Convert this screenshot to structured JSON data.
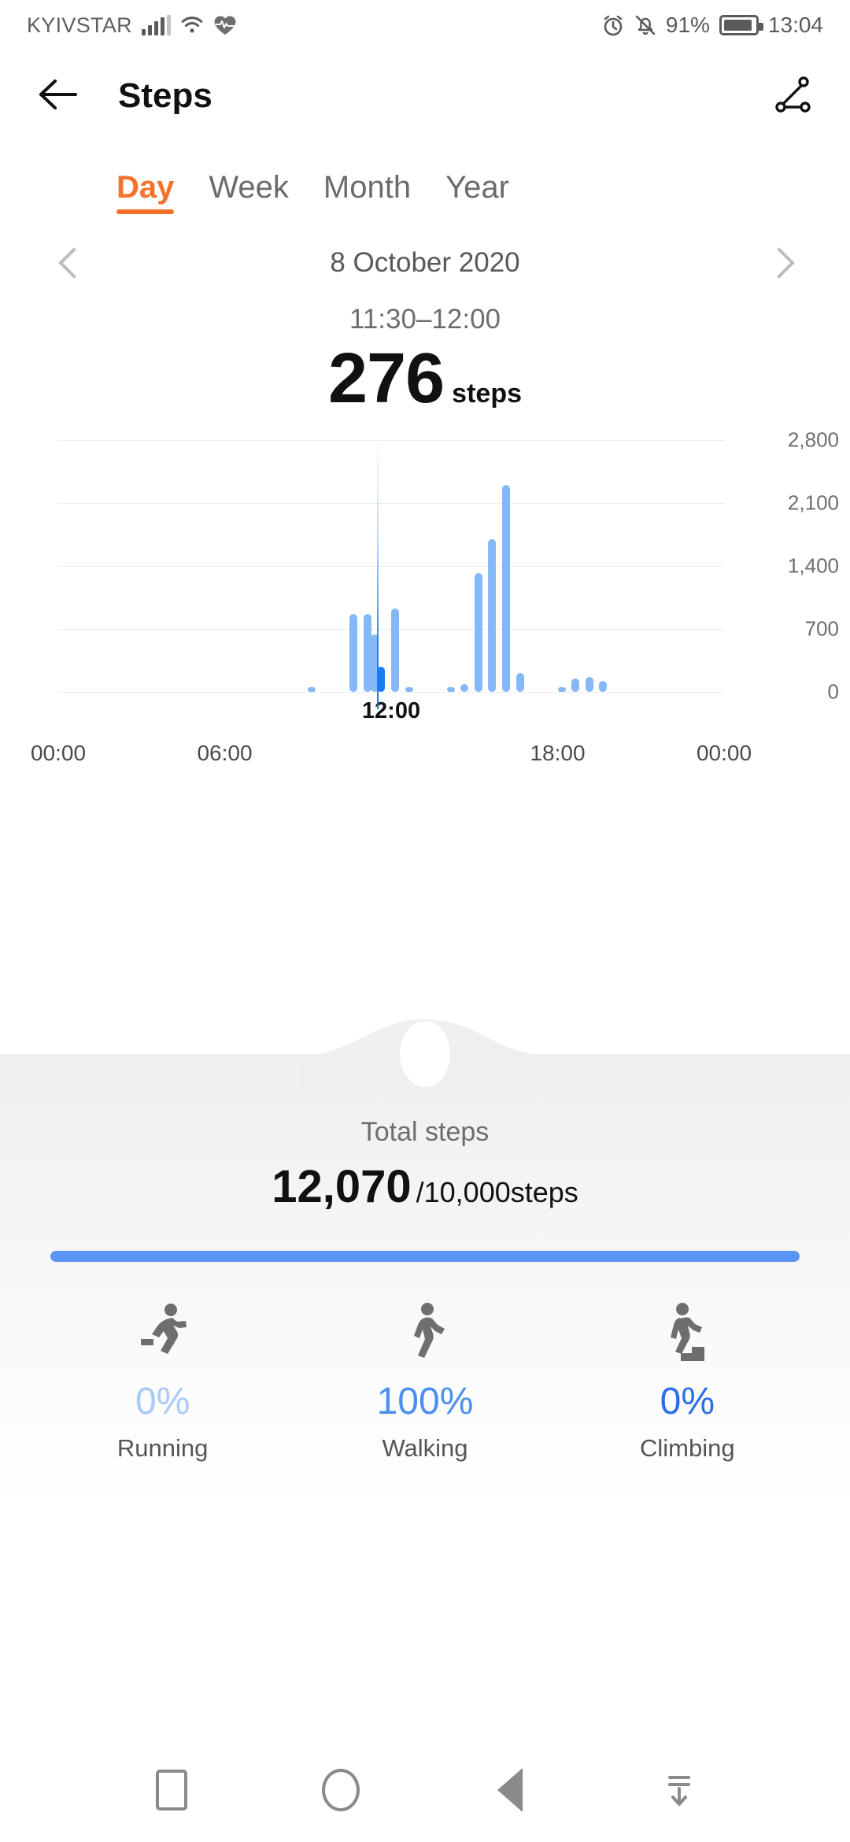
{
  "status_bar": {
    "carrier": "KYIVSTAR",
    "signal_icon": "signal-bars-icon",
    "wifi_icon": "wifi-icon",
    "health_icon": "heart-rate-icon",
    "alarm_icon": "alarm-clock-icon",
    "mute_icon": "bell-muted-icon",
    "battery_percent": "91%",
    "battery_icon": "battery-icon",
    "time": "13:04"
  },
  "header": {
    "back_icon": "back-arrow-icon",
    "title": "Steps",
    "share_icon": "share-icon"
  },
  "tabs": [
    {
      "label": "Day",
      "active": true
    },
    {
      "label": "Week",
      "active": false
    },
    {
      "label": "Month",
      "active": false
    },
    {
      "label": "Year",
      "active": false
    }
  ],
  "date_nav": {
    "prev_icon": "chevron-left-icon",
    "date": "8 October 2020",
    "next_icon": "chevron-right-icon"
  },
  "selection": {
    "time_range": "11:30–12:00",
    "value": "276",
    "unit": "steps"
  },
  "chart_data": {
    "type": "bar",
    "title": "Steps per 30-minute interval",
    "xlabel": "",
    "ylabel": "steps",
    "ylim": [
      0,
      2800
    ],
    "ytick_labels": [
      "0",
      "700",
      "1,400",
      "2,100",
      "2,800"
    ],
    "yticks": [
      0,
      700,
      1400,
      2100,
      2800
    ],
    "xtick_labels": [
      "00:00",
      "06:00",
      "18:00",
      "00:00"
    ],
    "xticks": [
      0,
      6,
      18,
      24
    ],
    "grid": true,
    "legend": "none",
    "cursor_label": "12:00",
    "cursor_x": 12,
    "selected_index": 23,
    "bar_color": "#85B8F7",
    "selected_bar_color": "#1A7CF0",
    "x": [
      0,
      0.5,
      1,
      1.5,
      2,
      2.5,
      3,
      3.5,
      4,
      4.5,
      5,
      5.5,
      6,
      6.5,
      7,
      7.5,
      8,
      8.5,
      9,
      9.5,
      10,
      10.5,
      11,
      11.5,
      12,
      12.5,
      13,
      13.5,
      14,
      14.5,
      15,
      15.5,
      16,
      16.5,
      17,
      17.5,
      18,
      18.5,
      19,
      19.5,
      20,
      20.5,
      21,
      21.5,
      22,
      22.5,
      23,
      23.5
    ],
    "values": [
      0,
      0,
      0,
      0,
      0,
      0,
      0,
      0,
      0,
      0,
      0,
      0,
      0,
      0,
      0,
      0,
      0,
      0,
      30,
      0,
      0,
      0,
      0,
      0,
      0,
      0,
      0,
      0,
      0,
      0,
      0,
      0,
      0,
      0,
      0,
      0,
      0,
      0,
      0,
      0,
      0,
      0,
      0,
      0,
      0,
      0,
      0,
      0
    ],
    "series": [
      {
        "name": "Steps",
        "points": [
          {
            "time": "09:00",
            "value": 30
          },
          {
            "time": "10:30",
            "value": 870
          },
          {
            "time": "11:00",
            "value": 870
          },
          {
            "time": "11:15",
            "value": 640
          },
          {
            "time": "11:30",
            "value": 276,
            "selected": true
          },
          {
            "time": "12:00",
            "value": 930
          },
          {
            "time": "12:30",
            "value": 40
          },
          {
            "time": "14:00",
            "value": 55
          },
          {
            "time": "14:30",
            "value": 85
          },
          {
            "time": "15:00",
            "value": 1320
          },
          {
            "time": "15:30",
            "value": 1700
          },
          {
            "time": "16:00",
            "value": 2300
          },
          {
            "time": "16:30",
            "value": 210
          },
          {
            "time": "18:00",
            "value": 35
          },
          {
            "time": "18:30",
            "value": 150
          },
          {
            "time": "19:00",
            "value": 165
          },
          {
            "time": "19:30",
            "value": 120
          }
        ]
      }
    ]
  },
  "summary": {
    "total_label": "Total steps",
    "total_value": "12,070",
    "goal_text": "/10,000steps",
    "progress_percent": 100,
    "progress_color": "#5A94F5"
  },
  "activities": [
    {
      "icon": "running-person-icon",
      "percent": "0%",
      "name": "Running",
      "color": "#A8CBF8"
    },
    {
      "icon": "walking-person-icon",
      "percent": "100%",
      "name": "Walking",
      "color": "#4B90F0"
    },
    {
      "icon": "climbing-person-icon",
      "percent": "0%",
      "name": "Climbing",
      "color": "#2B6FE8"
    }
  ],
  "nav_bar": {
    "recents_icon": "recents-square-icon",
    "home_icon": "home-circle-icon",
    "back_icon": "back-triangle-icon",
    "hide_icon": "hide-navbar-icon"
  },
  "theme": {
    "accent_orange": "#F4722B",
    "accent_blue": "#5A94F5",
    "bar_blue": "#85B8F7",
    "selected_blue": "#1A7CF0"
  }
}
